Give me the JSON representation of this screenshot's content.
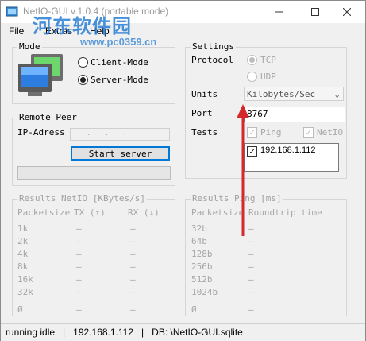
{
  "window": {
    "title": "NetIO-GUI v.1.0.4 (portable mode)",
    "watermark": "河东软件园",
    "watermark_url": "www.pc0359.cn"
  },
  "menu": {
    "file": "File",
    "extras": "Extras",
    "help": "Help"
  },
  "mode": {
    "label": "Mode",
    "client": "Client-Mode",
    "server": "Server-Mode",
    "selected": "server"
  },
  "remote_peer": {
    "label": "Remote Peer",
    "ip_label": "IP-Adress",
    "ip_value": " .  .  . ",
    "start_button": "Start server"
  },
  "settings": {
    "label": "Settings",
    "protocol_label": "Protocol",
    "tcp": "TCP",
    "udp": "UDP",
    "units_label": "Units",
    "units_value": "Kilobytes/Sec",
    "port_label": "Port",
    "port_value": "8767",
    "tests_label": "Tests",
    "ping": "Ping",
    "netio": "NetIO",
    "hosts": [
      "192.168.1.112"
    ]
  },
  "results_netio": {
    "label": "Results NetIO [KBytes/s]",
    "col_packetsize": "Packetsize",
    "col_tx": "TX (↑)",
    "col_rx": "RX (↓)",
    "rows": [
      {
        "size": "1k",
        "tx": "–",
        "rx": "–"
      },
      {
        "size": "2k",
        "tx": "–",
        "rx": "–"
      },
      {
        "size": "4k",
        "tx": "–",
        "rx": "–"
      },
      {
        "size": "8k",
        "tx": "–",
        "rx": "–"
      },
      {
        "size": "16k",
        "tx": "–",
        "rx": "–"
      },
      {
        "size": "32k",
        "tx": "–",
        "rx": "–"
      },
      {
        "size": "Ø",
        "tx": "–",
        "rx": "–"
      }
    ]
  },
  "results_ping": {
    "label": "Results Ping [ms]",
    "col_packetsize": "Packetsize",
    "col_roundtrip": "Roundtrip time",
    "rows": [
      {
        "size": "32b",
        "rt": "–"
      },
      {
        "size": "64b",
        "rt": "–"
      },
      {
        "size": "128b",
        "rt": "–"
      },
      {
        "size": "256b",
        "rt": "–"
      },
      {
        "size": "512b",
        "rt": "–"
      },
      {
        "size": "1024b",
        "rt": "–"
      },
      {
        "size": "Ø",
        "rt": "–"
      }
    ]
  },
  "status": {
    "state": "running idle",
    "ip": "192.168.1.112",
    "db": "DB: \\NetIO-GUI.sqlite",
    "sep": "   |   "
  },
  "colors": {
    "annotation_arrow": "#d42a2a",
    "watermark": "#2a7fd4"
  }
}
